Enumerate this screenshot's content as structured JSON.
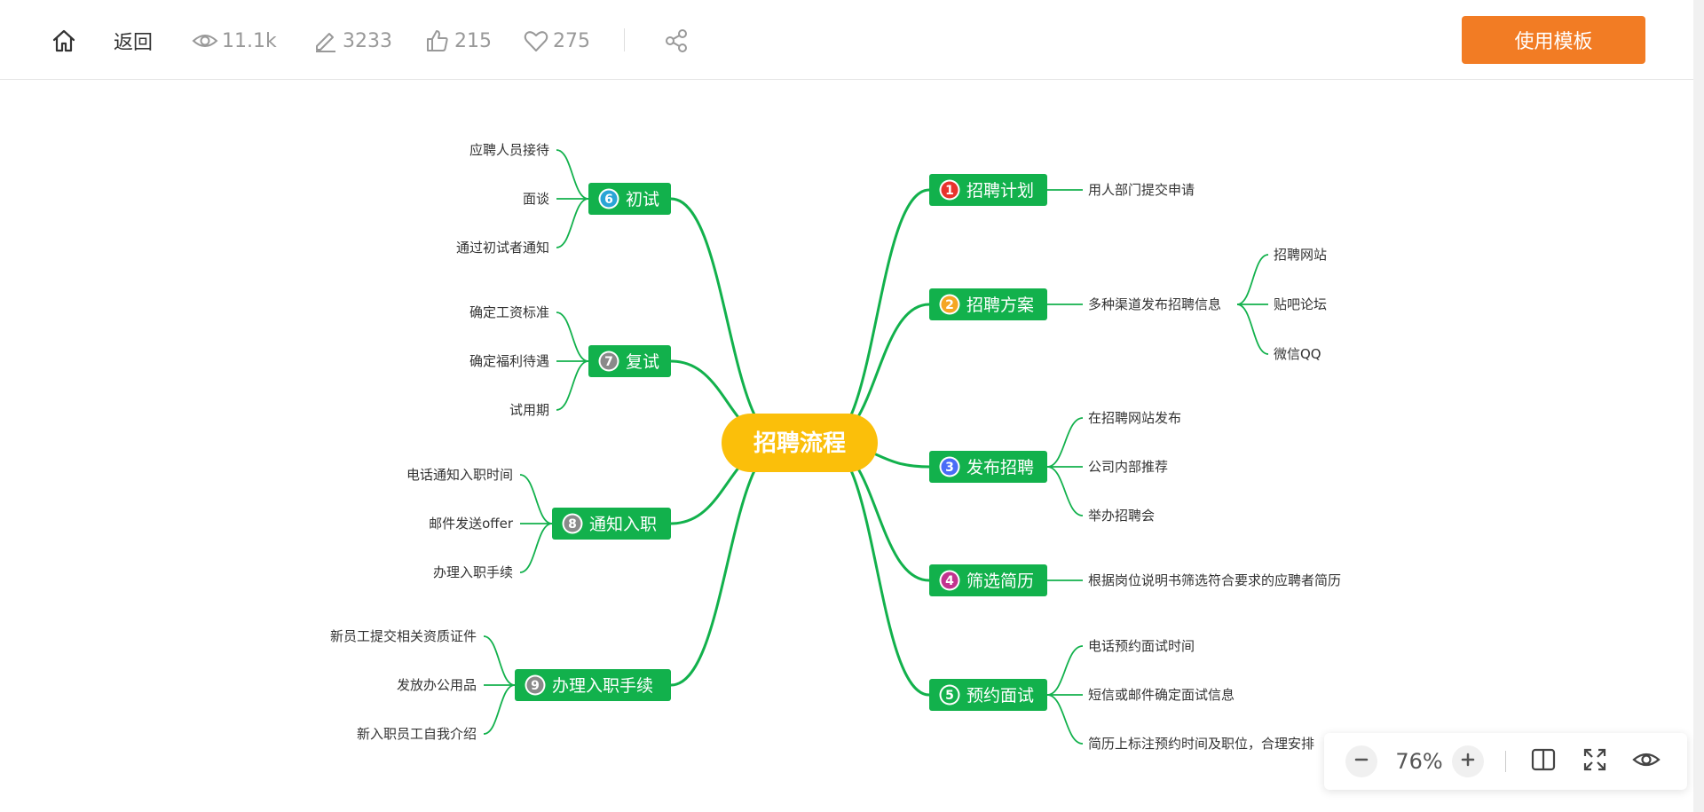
{
  "toolbar": {
    "back_label": "返回",
    "views": "11.1k",
    "edits": "3233",
    "likes": "215",
    "favorites": "275",
    "use_template_label": "使用模板",
    "accent_color": "#f27c24"
  },
  "icons": {
    "home": "home-icon",
    "views": "eye-icon",
    "edits": "pencil-icon",
    "likes": "thumbs-up-icon",
    "favorites": "heart-icon",
    "share": "share-icon",
    "zoom_out": "minus-icon",
    "zoom_in": "plus-icon",
    "split": "split-view-icon",
    "fullscreen": "fullscreen-icon",
    "preview": "eye-icon"
  },
  "zoom": {
    "level": "76%"
  },
  "mindmap": {
    "root": "招聘流程",
    "colors": {
      "root": "#fbbf0a",
      "branch": "#12b14c",
      "line": "#12b14c",
      "text": "#333333"
    },
    "right": [
      {
        "num": "1",
        "badge_color": "#e8332d",
        "label": "招聘计划",
        "children": [
          {
            "label": "用人部门提交申请"
          }
        ]
      },
      {
        "num": "2",
        "badge_color": "#f5a623",
        "label": "招聘方案",
        "children": [
          {
            "label": "多种渠道发布招聘信息",
            "children": [
              "招聘网站",
              "贴吧论坛",
              "微信QQ"
            ]
          }
        ]
      },
      {
        "num": "3",
        "badge_color": "#4a6cf7",
        "label": "发布招聘",
        "children": [
          {
            "label": "在招聘网站发布"
          },
          {
            "label": "公司内部推荐"
          },
          {
            "label": "举办招聘会"
          }
        ]
      },
      {
        "num": "4",
        "badge_color": "#c2338f",
        "label": "筛选简历",
        "children": [
          {
            "label": "根据岗位说明书筛选符合要求的应聘者简历"
          }
        ]
      },
      {
        "num": "5",
        "badge_color": "#12b14c",
        "label": "预约面试",
        "children": [
          {
            "label": "电话预约面试时间"
          },
          {
            "label": "短信或邮件确定面试信息"
          },
          {
            "label": "简历上标注预约时间及职位，合理安排"
          }
        ]
      }
    ],
    "left": [
      {
        "num": "6",
        "badge_color": "#2aa5d6",
        "label": "初试",
        "children": [
          "应聘人员接待",
          "面谈",
          "通过初试者通知"
        ]
      },
      {
        "num": "7",
        "badge_color": "#8a8a8a",
        "label": "复试",
        "children": [
          "确定工资标准",
          "确定福利待遇",
          "试用期"
        ]
      },
      {
        "num": "8",
        "badge_color": "#8a8a8a",
        "label": "通知入职",
        "children": [
          "电话通知入职时间",
          "邮件发送offer",
          "办理入职手续"
        ]
      },
      {
        "num": "9",
        "badge_color": "#8a8a8a",
        "label": "办理入职手续",
        "children": [
          "新员工提交相关资质证件",
          "发放办公用品",
          "新入职员工自我介绍"
        ]
      }
    ]
  }
}
